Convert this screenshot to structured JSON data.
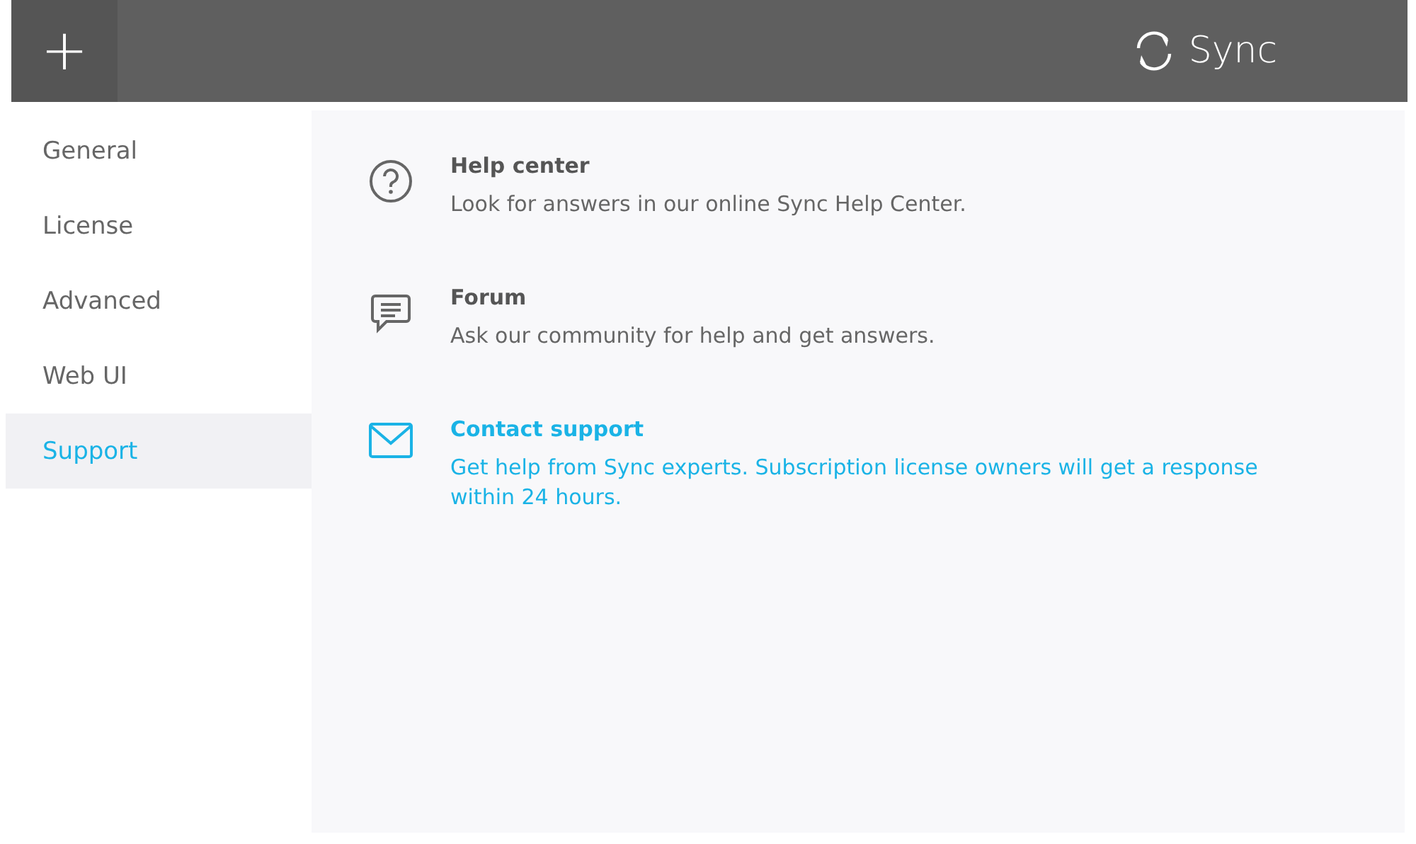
{
  "header": {
    "add_button": "+",
    "brand": "Sync"
  },
  "sidebar": {
    "items": [
      {
        "label": "General",
        "selected": false
      },
      {
        "label": "License",
        "selected": false
      },
      {
        "label": "Advanced",
        "selected": false
      },
      {
        "label": "Web UI",
        "selected": false
      },
      {
        "label": "Support",
        "selected": true
      }
    ]
  },
  "support_items": [
    {
      "kind": "help",
      "title": "Help center",
      "description": "Look for answers in our online Sync Help Center.",
      "hovered": false
    },
    {
      "kind": "forum",
      "title": "Forum",
      "description": "Ask our community for help and get answers.",
      "hovered": false
    },
    {
      "kind": "contact",
      "title": "Contact support",
      "description": "Get help from Sync experts. Subscription license owners will get a response within 24 hours.",
      "hovered": true
    }
  ]
}
